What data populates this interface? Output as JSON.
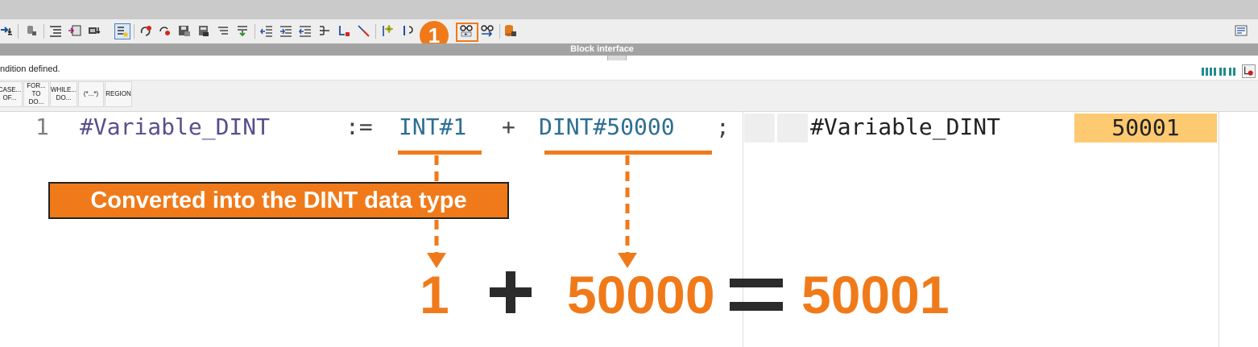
{
  "step_badge": "1",
  "block_interface": {
    "title": "Block interface"
  },
  "info": {
    "text": "ndition defined."
  },
  "keywords": [
    {
      "line1": "CASE...",
      "line2": "OF..."
    },
    {
      "line1": "FOR...",
      "line2": "TO DO..."
    },
    {
      "line1": "WHILE...",
      "line2": "DO..."
    },
    {
      "line1": "(*...*)",
      "line2": ""
    },
    {
      "line1": "REGION",
      "line2": ""
    }
  ],
  "code": {
    "line_number": "1",
    "target": "#Variable_DINT",
    "assign_op": ":=",
    "operand1": "INT#1",
    "plus_op": "+",
    "operand2": "DINT#50000",
    "terminator": ";"
  },
  "monitor": {
    "variable": "#Variable_DINT",
    "value": "50001"
  },
  "annotation": {
    "callout": "Converted into the DINT data type",
    "operand1": "1",
    "operand2": "50000",
    "result": "50001"
  },
  "colors": {
    "accent": "#f07a1a",
    "monitor_value_bg": "#fdc971",
    "code_variable": "#5a4e8c",
    "code_constant": "#2c6f94"
  },
  "toolbar_icons": [
    "download-arrow-icon",
    "cylinder-icon",
    "list-indent-icon",
    "list-arrow-icon",
    "module-down-icon",
    "star-list-icon",
    "reset-red-icon",
    "go-red-icon",
    "disk-icon",
    "save-icon",
    "lines-icon",
    "green-down-icon",
    "left-indent-icon",
    "right-indent-icon",
    "outdent-icon",
    "tree-icon",
    "bracket-icon",
    "red-line-icon",
    "flag-star-icon",
    "back-icon",
    "glasses-icon",
    "monitoring-on-icon",
    "monitoring-modify-icon",
    "database-icon"
  ]
}
